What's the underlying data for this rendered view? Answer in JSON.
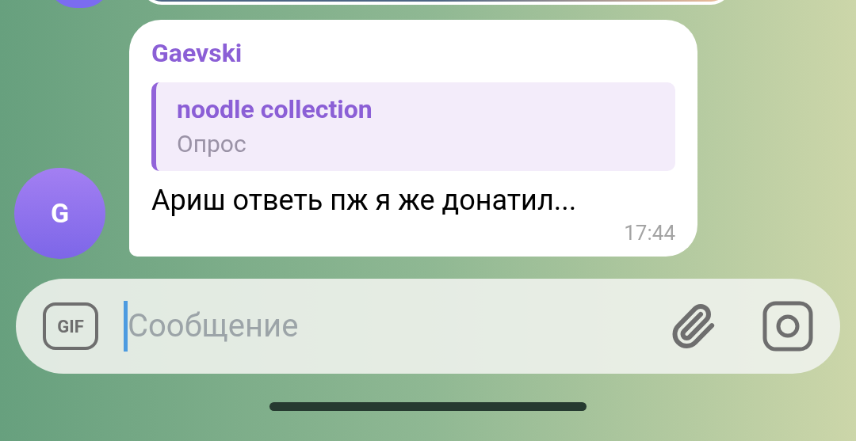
{
  "message": {
    "avatar_letter": "G",
    "sender": "Gaevski",
    "reply": {
      "title": "noodle collection",
      "subtitle": "Опрос"
    },
    "text": "Ариш ответь пж я же донатил...",
    "time": "17:44"
  },
  "composer": {
    "gif_label": "GIF",
    "placeholder": "Сообщение",
    "focused": true
  }
}
